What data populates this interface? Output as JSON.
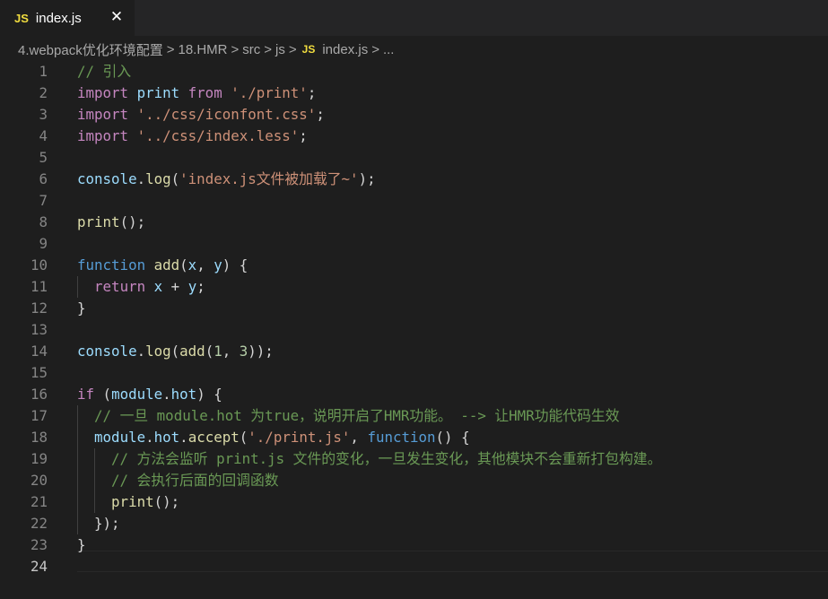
{
  "tab": {
    "badge": "JS",
    "label": "index.js",
    "close_glyph": "✕"
  },
  "breadcrumb": {
    "items": [
      "4.webpack优化环境配置",
      "18.HMR",
      "src",
      "js"
    ],
    "file_badge": "JS",
    "file": "index.js",
    "trailing": "...",
    "separator": ">"
  },
  "editor": {
    "active_line": 24,
    "lines": [
      {
        "n": "1",
        "tokens": [
          {
            "t": "// 引入",
            "c": "com"
          }
        ]
      },
      {
        "n": "2",
        "tokens": [
          {
            "t": "import",
            "c": "kw"
          },
          {
            "t": " print ",
            "c": "var"
          },
          {
            "t": "from",
            "c": "kw"
          },
          {
            "t": " ",
            "c": "p"
          },
          {
            "t": "'./print'",
            "c": "str"
          },
          {
            "t": ";",
            "c": "p"
          }
        ]
      },
      {
        "n": "3",
        "tokens": [
          {
            "t": "import",
            "c": "kw"
          },
          {
            "t": " ",
            "c": "p"
          },
          {
            "t": "'../css/iconfont.css'",
            "c": "str"
          },
          {
            "t": ";",
            "c": "p"
          }
        ]
      },
      {
        "n": "4",
        "tokens": [
          {
            "t": "import",
            "c": "kw"
          },
          {
            "t": " ",
            "c": "p"
          },
          {
            "t": "'../css/index.less'",
            "c": "str"
          },
          {
            "t": ";",
            "c": "p"
          }
        ]
      },
      {
        "n": "5",
        "tokens": []
      },
      {
        "n": "6",
        "tokens": [
          {
            "t": "console",
            "c": "var"
          },
          {
            "t": ".",
            "c": "p"
          },
          {
            "t": "log",
            "c": "fn"
          },
          {
            "t": "(",
            "c": "p"
          },
          {
            "t": "'index.js文件被加载了~'",
            "c": "str"
          },
          {
            "t": ");",
            "c": "p"
          }
        ]
      },
      {
        "n": "7",
        "tokens": []
      },
      {
        "n": "8",
        "tokens": [
          {
            "t": "print",
            "c": "fn"
          },
          {
            "t": "();",
            "c": "p"
          }
        ]
      },
      {
        "n": "9",
        "tokens": []
      },
      {
        "n": "10",
        "tokens": [
          {
            "t": "function",
            "c": "blue"
          },
          {
            "t": " ",
            "c": "p"
          },
          {
            "t": "add",
            "c": "fn"
          },
          {
            "t": "(",
            "c": "p"
          },
          {
            "t": "x",
            "c": "var"
          },
          {
            "t": ", ",
            "c": "p"
          },
          {
            "t": "y",
            "c": "var"
          },
          {
            "t": ") {",
            "c": "p"
          }
        ]
      },
      {
        "n": "11",
        "tokens": [
          {
            "t": "  ",
            "c": "p"
          },
          {
            "t": "return",
            "c": "kw"
          },
          {
            "t": " x ",
            "c": "var"
          },
          {
            "t": "+ ",
            "c": "p"
          },
          {
            "t": "y",
            "c": "var"
          },
          {
            "t": ";",
            "c": "p"
          }
        ]
      },
      {
        "n": "12",
        "tokens": [
          {
            "t": "}",
            "c": "p"
          }
        ]
      },
      {
        "n": "13",
        "tokens": []
      },
      {
        "n": "14",
        "tokens": [
          {
            "t": "console",
            "c": "var"
          },
          {
            "t": ".",
            "c": "p"
          },
          {
            "t": "log",
            "c": "fn"
          },
          {
            "t": "(",
            "c": "p"
          },
          {
            "t": "add",
            "c": "fn"
          },
          {
            "t": "(",
            "c": "p"
          },
          {
            "t": "1",
            "c": "num"
          },
          {
            "t": ", ",
            "c": "p"
          },
          {
            "t": "3",
            "c": "num"
          },
          {
            "t": "));",
            "c": "p"
          }
        ]
      },
      {
        "n": "15",
        "tokens": []
      },
      {
        "n": "16",
        "tokens": [
          {
            "t": "if",
            "c": "kw"
          },
          {
            "t": " (",
            "c": "p"
          },
          {
            "t": "module",
            "c": "var"
          },
          {
            "t": ".",
            "c": "p"
          },
          {
            "t": "hot",
            "c": "var"
          },
          {
            "t": ") {",
            "c": "p"
          }
        ]
      },
      {
        "n": "17",
        "tokens": [
          {
            "t": "  ",
            "c": "p"
          },
          {
            "t": "// 一旦 module.hot 为true，说明开启了HMR功能。 --> 让HMR功能代码生效",
            "c": "com"
          }
        ]
      },
      {
        "n": "18",
        "tokens": [
          {
            "t": "  ",
            "c": "p"
          },
          {
            "t": "module",
            "c": "var"
          },
          {
            "t": ".",
            "c": "p"
          },
          {
            "t": "hot",
            "c": "var"
          },
          {
            "t": ".",
            "c": "p"
          },
          {
            "t": "accept",
            "c": "fn"
          },
          {
            "t": "(",
            "c": "p"
          },
          {
            "t": "'./print.js'",
            "c": "str"
          },
          {
            "t": ", ",
            "c": "p"
          },
          {
            "t": "function",
            "c": "blue"
          },
          {
            "t": "() {",
            "c": "p"
          }
        ]
      },
      {
        "n": "19",
        "tokens": [
          {
            "t": "    ",
            "c": "p"
          },
          {
            "t": "// 方法会监听 print.js 文件的变化，一旦发生变化，其他模块不会重新打包构建。",
            "c": "com"
          }
        ]
      },
      {
        "n": "20",
        "tokens": [
          {
            "t": "    ",
            "c": "p"
          },
          {
            "t": "// 会执行后面的回调函数",
            "c": "com"
          }
        ]
      },
      {
        "n": "21",
        "tokens": [
          {
            "t": "    ",
            "c": "p"
          },
          {
            "t": "print",
            "c": "fn"
          },
          {
            "t": "();",
            "c": "p"
          }
        ]
      },
      {
        "n": "22",
        "tokens": [
          {
            "t": "  });",
            "c": "p"
          }
        ]
      },
      {
        "n": "23",
        "tokens": [
          {
            "t": "}",
            "c": "p"
          }
        ]
      },
      {
        "n": "24",
        "tokens": []
      }
    ]
  },
  "colors": {
    "background": "#1e1e1e",
    "tabbar": "#252526",
    "js_badge": "#f1dd3f",
    "comment": "#6a9955",
    "keyword": "#c586c0",
    "string": "#ce9178",
    "variable": "#9cdcfe",
    "function": "#dcdcaa",
    "number": "#b5cea8",
    "storage": "#569cd6"
  }
}
